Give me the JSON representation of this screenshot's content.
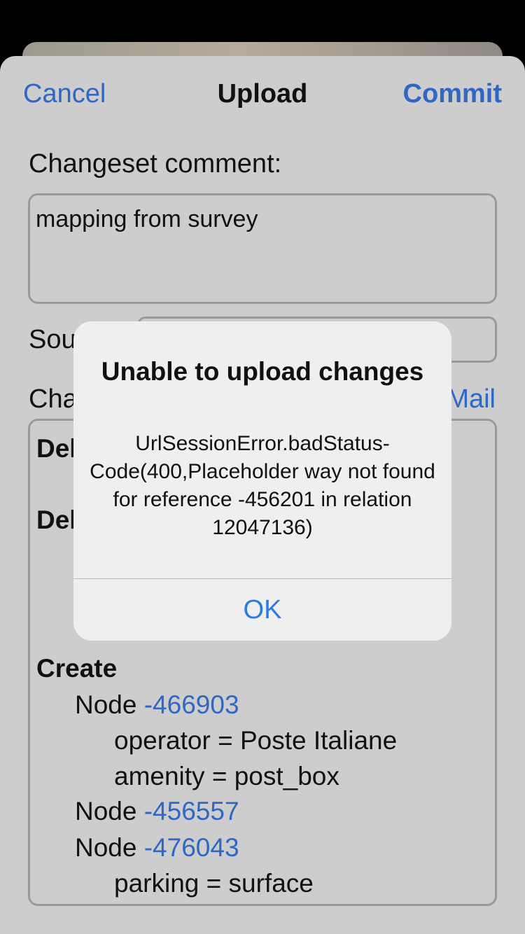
{
  "nav": {
    "cancel_label": "Cancel",
    "title": "Upload",
    "commit_label": "Commit"
  },
  "form": {
    "comment_label": "Changeset comment:",
    "comment_value": "mapping from survey",
    "source_label": "Sou",
    "changes_label": "Cha",
    "mail_label": "Mail"
  },
  "changes": {
    "lines": [
      {
        "text": "Del",
        "kind": "heading"
      },
      {
        "text": "Del",
        "kind": "heading"
      },
      {
        "text": "Create",
        "kind": "heading"
      },
      {
        "text": "Node",
        "id": "-466903",
        "kind": "node"
      },
      {
        "text": "operator = Poste Italiane",
        "kind": "tag"
      },
      {
        "text": "amenity = post_box",
        "kind": "tag"
      },
      {
        "text": "Node",
        "id": "-456557",
        "kind": "node"
      },
      {
        "text": "Node",
        "id": "-476043",
        "kind": "node"
      },
      {
        "text": "parking = surface",
        "kind": "tag"
      }
    ]
  },
  "alert": {
    "title": "Unable to upload changes",
    "message": "UrlSessionError.badStatus-Code(400,Placeholder way not found for reference -456201 in relation 12047136)",
    "ok_label": "OK"
  },
  "colors": {
    "accent": "#2e67c4",
    "sheet_bg": "#cdcdcd",
    "alert_bg": "#efefef"
  }
}
